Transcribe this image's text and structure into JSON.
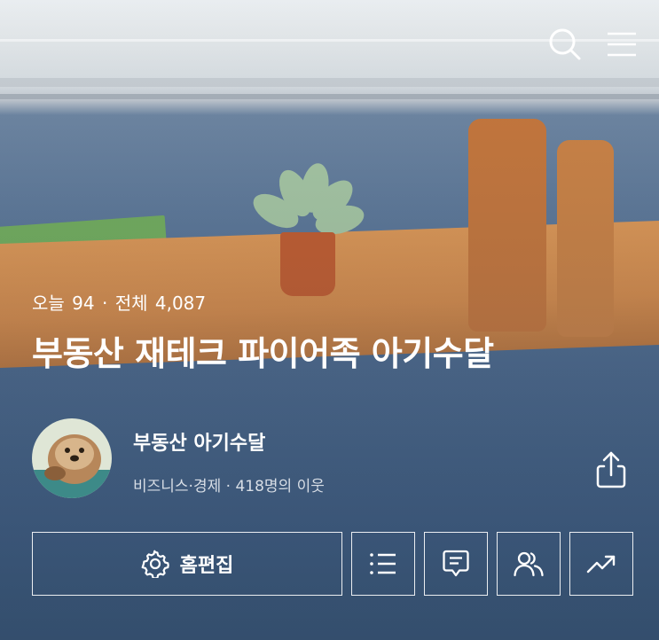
{
  "header": {
    "search_icon": "search-icon",
    "menu_icon": "hamburger-menu-icon"
  },
  "stats": {
    "today_label": "오늘",
    "today_count": "94",
    "separator": "·",
    "total_label": "전체",
    "total_count": "4,087"
  },
  "blog": {
    "title": "부동산 재테크 파이어족 아기수달"
  },
  "profile": {
    "name": "부동산 아기수달",
    "category": "비즈니스·경제",
    "neighbors": "· 418명의 이웃"
  },
  "actions": {
    "edit_home_label": "홈편집",
    "edit_home_icon": "gear-icon",
    "list_icon": "list-icon",
    "comment_icon": "comment-icon",
    "neighbors_icon": "people-icon",
    "stats_icon": "trend-icon"
  },
  "share_icon": "share-icon"
}
